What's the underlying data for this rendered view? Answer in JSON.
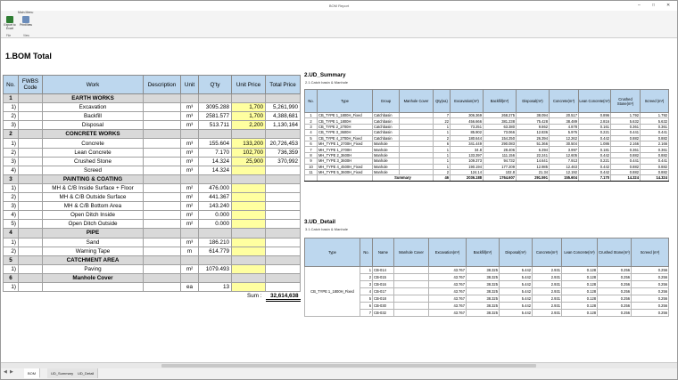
{
  "window": {
    "title": "BOM Report"
  },
  "ribbon": {
    "tab": "Main Menu",
    "buttons": [
      {
        "label": "Export to Excel"
      },
      {
        "label": "PrintView"
      }
    ],
    "groups": [
      "File",
      "View"
    ]
  },
  "bom": {
    "title": "1.BOM Total",
    "headers": [
      "No.",
      "FWBS Code",
      "Work",
      "Description",
      "Unit",
      "Q'ty",
      "Unit Price",
      "Total Price"
    ],
    "rows": [
      {
        "type": "sec",
        "no": "1",
        "work": "EARTH WORKS"
      },
      {
        "type": "item",
        "no": "1)",
        "work": "Excavation",
        "unit": "m³",
        "qty": "3095.288",
        "price": "1,700",
        "total": "5,261,990"
      },
      {
        "type": "item",
        "no": "2)",
        "work": "Backfill",
        "unit": "m³",
        "qty": "2581.577",
        "price": "1,700",
        "total": "4,388,681"
      },
      {
        "type": "item",
        "no": "3)",
        "work": "Disposal",
        "unit": "m³",
        "qty": "513.711",
        "price": "2,200",
        "total": "1,130,164"
      },
      {
        "type": "sec",
        "no": "2",
        "work": "CONCRETE WORKS"
      },
      {
        "type": "item",
        "no": "1)",
        "work": "Concrete",
        "unit": "m³",
        "qty": "155.604",
        "price": "133,200",
        "total": "20,726,453"
      },
      {
        "type": "item",
        "no": "2)",
        "work": "Lean Concrete",
        "unit": "m³",
        "qty": "7.170",
        "price": "102,700",
        "total": "736,359"
      },
      {
        "type": "item",
        "no": "3)",
        "work": "Crushed Stone",
        "unit": "m³",
        "qty": "14.324",
        "price": "25,900",
        "total": "370,992"
      },
      {
        "type": "item",
        "no": "4)",
        "work": "Screed",
        "unit": "m³",
        "qty": "14.324",
        "price": "",
        "total": ""
      },
      {
        "type": "sec",
        "no": "3",
        "work": "PAINTING & COATING"
      },
      {
        "type": "item",
        "no": "1)",
        "work": "MH & C/B Inside Surface + Floor",
        "unit": "m²",
        "qty": "476.000",
        "price": "",
        "total": ""
      },
      {
        "type": "item",
        "no": "2)",
        "work": "MH & C/B Outside Surface",
        "unit": "m²",
        "qty": "441.367",
        "price": "",
        "total": ""
      },
      {
        "type": "item",
        "no": "3)",
        "work": "MH & C/B Bottom Area",
        "unit": "m²",
        "qty": "143.240",
        "price": "",
        "total": ""
      },
      {
        "type": "item",
        "no": "4)",
        "work": "Open Ditch Inside",
        "unit": "m²",
        "qty": "0.000",
        "price": "",
        "total": ""
      },
      {
        "type": "item",
        "no": "5)",
        "work": "Open Ditch Outside",
        "unit": "m²",
        "qty": "0.000",
        "price": "",
        "total": ""
      },
      {
        "type": "sec",
        "no": "4",
        "work": "PIPE"
      },
      {
        "type": "item",
        "no": "1)",
        "work": "Sand",
        "unit": "m³",
        "qty": "186.210",
        "price": "",
        "total": ""
      },
      {
        "type": "item",
        "no": "2)",
        "work": "Warning Tape",
        "unit": "m",
        "qty": "614.779",
        "price": "",
        "total": ""
      },
      {
        "type": "sec",
        "no": "5",
        "work": "CATCHMENT AREA"
      },
      {
        "type": "item",
        "no": "1)",
        "work": "Paving",
        "unit": "m²",
        "qty": "1079.493",
        "price": "",
        "total": ""
      },
      {
        "type": "sec",
        "no": "6",
        "work": "Manhole Cover"
      },
      {
        "type": "item",
        "no": "1)",
        "work": "",
        "unit": "ea",
        "qty": "13",
        "price": "",
        "total": ""
      }
    ],
    "sum_label": "Sum :",
    "sum_value": "32,614,638"
  },
  "ud_summary": {
    "title": "2.UD_Summary",
    "subtitle": "2.1.Catch basin & Manhole",
    "headers": [
      "No.",
      "Type",
      "Group",
      "Manhole Cover",
      "Qty(ea)",
      "Excavation(m³)",
      "Backfill(m³)",
      "Disposal(m³)",
      "Concrete(m³)",
      "Lean Concrete(m³)",
      "Crushed Stone(m³)",
      "Screed (m³)"
    ],
    "rows": [
      [
        "1",
        "CB_TYPE 1_1800H_Fixed",
        "Catchbasin",
        "",
        "7",
        "306.369",
        "268.275",
        "38.094",
        "20.517",
        "0.896",
        "1.792",
        "1.792"
      ],
      [
        "2",
        "CB_TYPE 1_1800H",
        "Catchbasin",
        "",
        "22",
        "456.666",
        "381.238",
        "75.428",
        "38.489",
        "2.816",
        "5.632",
        "5.632"
      ],
      [
        "3",
        "CB_TYPE 2_2700H",
        "Catchbasin",
        "",
        "1",
        "73.251",
        "63.380",
        "9.862",
        "4.878",
        "0.161",
        "0.361",
        "0.361"
      ],
      [
        "4",
        "CB_TYPE 3_3600H",
        "Catchbasin",
        "",
        "1",
        "85.902",
        "73.066",
        "12.836",
        "5.976",
        "0.221",
        "0.441",
        "0.441"
      ],
      [
        "5",
        "CB_TYPE 4_2700H_Fixed",
        "Catchbasin",
        "",
        "2",
        "180.644",
        "154.250",
        "26.394",
        "12.262",
        "0.442",
        "0.882",
        "0.882"
      ],
      [
        "6",
        "MH_TYPE 1_2700H_Fixed",
        "Manhole",
        "",
        "6",
        "341.449",
        "290.083",
        "51.366",
        "30.504",
        "1.086",
        "2.166",
        "2.166"
      ],
      [
        "7",
        "MH_TYPE 1_2700H",
        "Manhole",
        "",
        "1",
        "34.8",
        "28.406",
        "6.394",
        "3.997",
        "0.181",
        "0.361",
        "0.361"
      ],
      [
        "8",
        "MH_TYPE 2_3600H",
        "Manhole",
        "",
        "1",
        "133.397",
        "111.156",
        "22.241",
        "12.605",
        "0.442",
        "0.882",
        "0.882"
      ],
      [
        "9",
        "MH_TYPE 3_3600H",
        "Manhole",
        "",
        "1",
        "109.373",
        "94.732",
        "14.641",
        "7.913",
        "0.221",
        "0.441",
        "0.441"
      ],
      [
        "10",
        "MH_TYPE 4_4500H_Fixed",
        "Manhole",
        "",
        "1",
        "190.194",
        "177.209",
        "12.985",
        "12.463",
        "0.442",
        "0.882",
        "0.882"
      ],
      [
        "11",
        "MH_TYPE 5_3600H_Fixed",
        "Manhole",
        "",
        "2",
        "124.14",
        "102.8",
        "21.34",
        "12.192",
        "0.442",
        "0.882",
        "0.882"
      ]
    ],
    "summary": [
      "Summary",
      "46",
      "2036.188",
      "1764.607",
      "291.591",
      "155.604",
      "7.170",
      "14.324",
      "14.324"
    ]
  },
  "ud_detail": {
    "title": "3.UD_Detail",
    "subtitle": "3.1.Catch basin & Manhole",
    "headers": [
      "Type",
      "No.",
      "Name",
      "Manhole Cover",
      "Excavation(m³)",
      "Backfill(m³)",
      "Disposal(m³)",
      "Concrete(m³)",
      "Lean Concrete(m³)",
      "Crushed Stone(m³)",
      "Screed (m³)"
    ],
    "type_value": "CB_TYPE 1_1800H_Fixed",
    "rows": [
      [
        "1",
        "CB-014",
        "",
        "43.767",
        "38.325",
        "5.442",
        "2.931",
        "0.128",
        "0.256",
        "0.256"
      ],
      [
        "2",
        "CB-015",
        "",
        "43.767",
        "38.325",
        "5.442",
        "2.931",
        "0.128",
        "0.256",
        "0.256"
      ],
      [
        "3",
        "CB-016",
        "",
        "43.767",
        "38.325",
        "5.442",
        "2.931",
        "0.128",
        "0.256",
        "0.256"
      ],
      [
        "4",
        "CB-017",
        "",
        "43.767",
        "38.325",
        "5.442",
        "2.931",
        "0.128",
        "0.256",
        "0.256"
      ],
      [
        "5",
        "CB-018",
        "",
        "43.767",
        "38.325",
        "5.442",
        "2.931",
        "0.128",
        "0.256",
        "0.256"
      ],
      [
        "6",
        "CB-030",
        "",
        "43.767",
        "38.325",
        "5.442",
        "2.931",
        "0.128",
        "0.256",
        "0.256"
      ],
      [
        "7",
        "CB-032",
        "",
        "43.767",
        "38.325",
        "5.442",
        "2.931",
        "0.128",
        "0.256",
        "0.256"
      ]
    ]
  },
  "sheet_tabs": [
    "BOM Total",
    "UD_Summary",
    "UD_Detail"
  ]
}
